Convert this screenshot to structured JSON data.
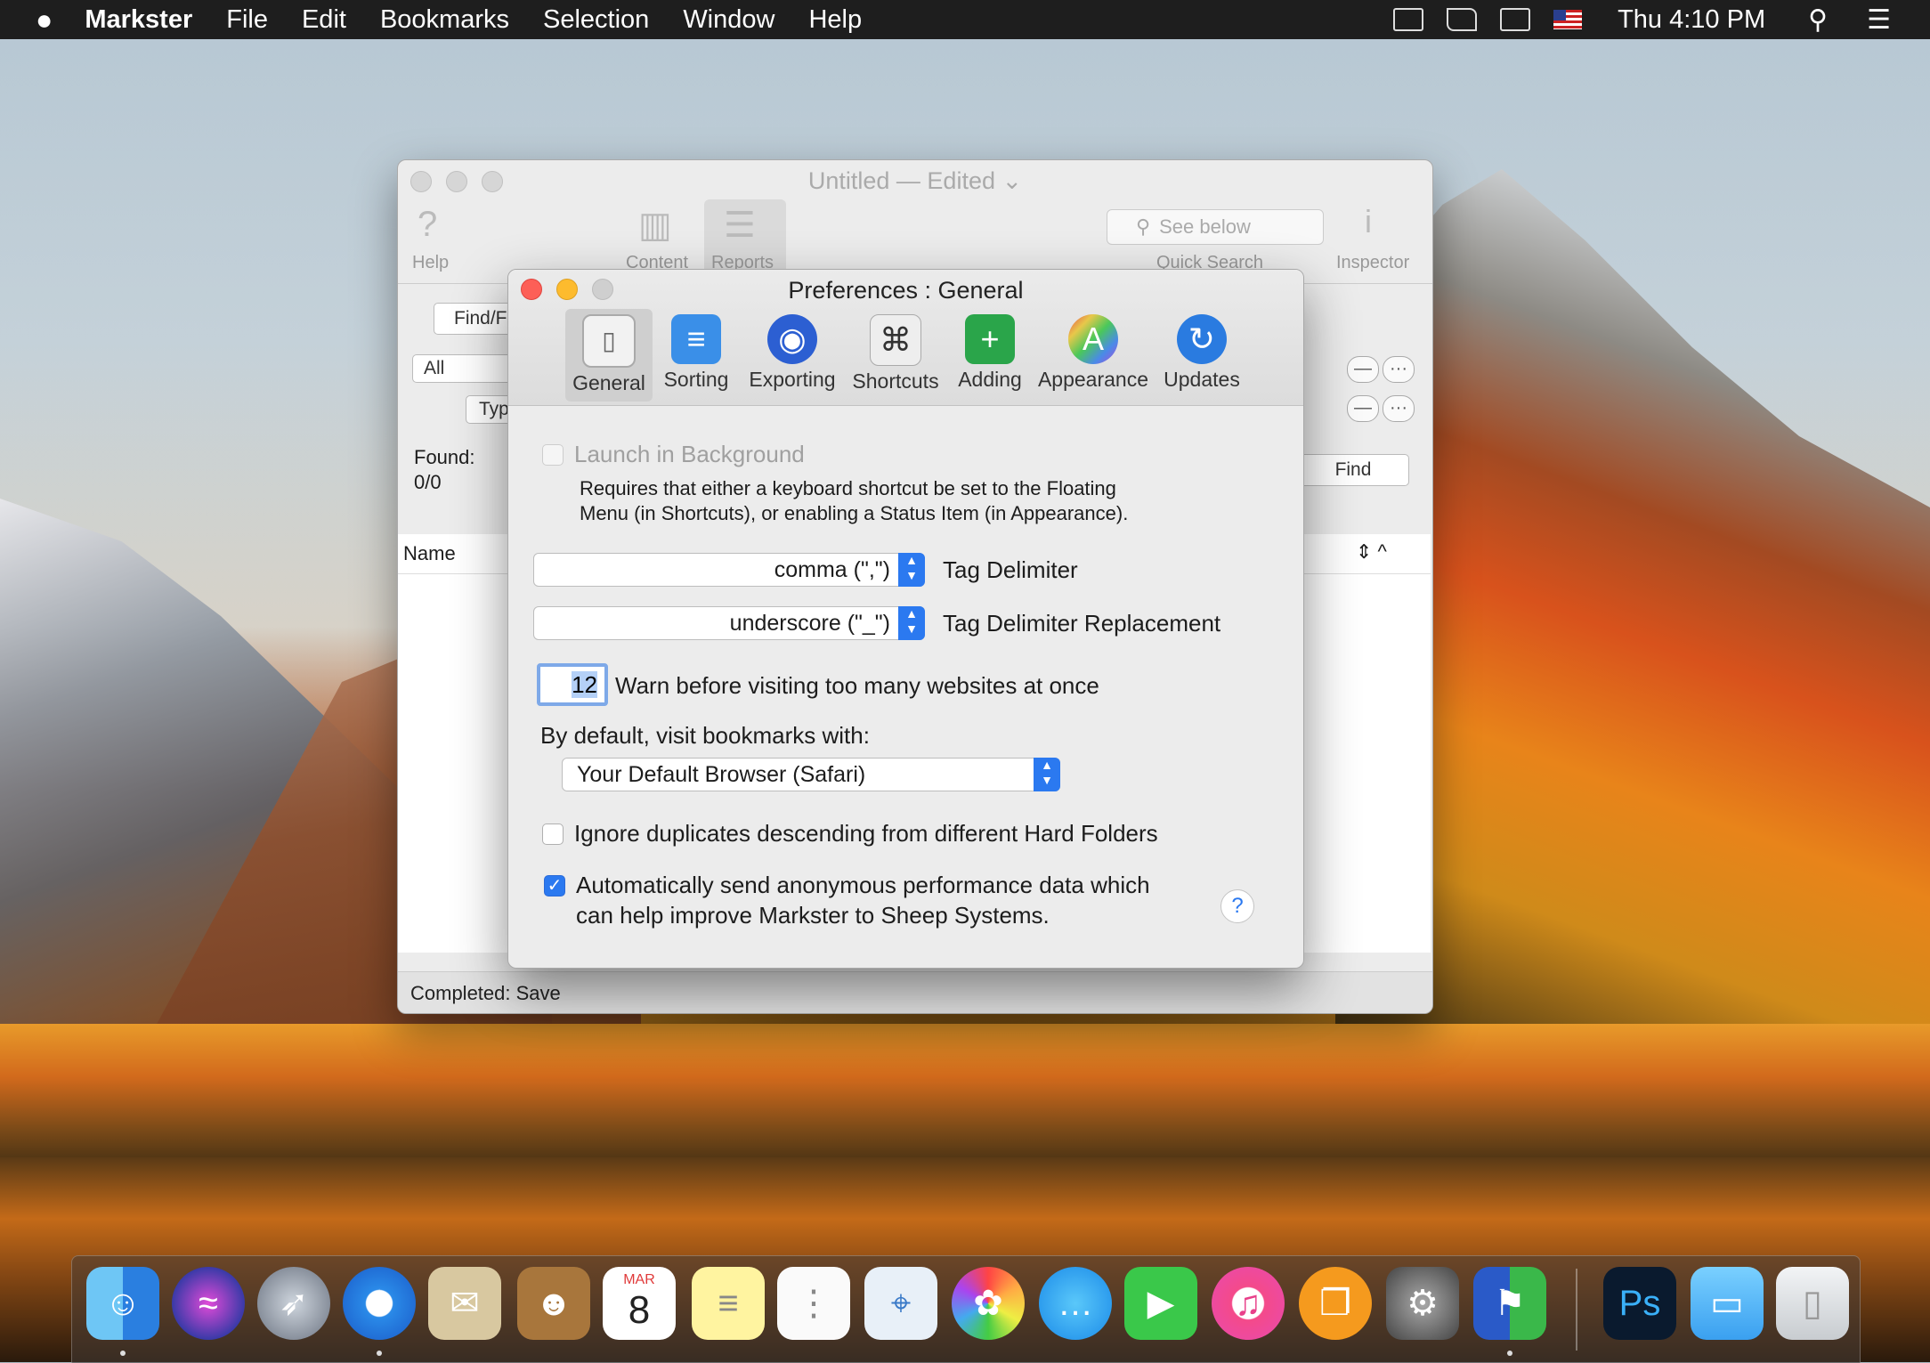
{
  "menubar": {
    "apple": "",
    "app_name": "Markster",
    "menus": [
      "File",
      "Edit",
      "Bookmarks",
      "Selection",
      "Window",
      "Help"
    ],
    "clock": "Thu 4:10 PM"
  },
  "main_window": {
    "title": "Untitled — Edited ⌄",
    "toolbar": {
      "help_label": "Help",
      "content_label": "Content",
      "reports_label": "Reports",
      "search_placeholder": "See below",
      "quick_search_label": "Quick Search",
      "inspector_label": "Inspector"
    },
    "find_button": "Find/F",
    "scope_popup": "All",
    "type_popup": "Typ",
    "found_label": "Found:",
    "found_value": "0/0",
    "find_action": "Find",
    "column_name": "Name",
    "status": "Completed: Save"
  },
  "prefs": {
    "title": "Preferences : General",
    "tabs": [
      {
        "label": "General",
        "icon": "general-switch-icon",
        "color": "#d8d8d8"
      },
      {
        "label": "Sorting",
        "icon": "sorting-stack-icon",
        "color": "#3a8fe8"
      },
      {
        "label": "Exporting",
        "icon": "exporting-arrows-icon",
        "color": "#2c5fd2"
      },
      {
        "label": "Shortcuts",
        "icon": "command-key-icon",
        "color": "#9a9a9a"
      },
      {
        "label": "Adding",
        "icon": "adding-plus-icon",
        "color": "#2aa54a"
      },
      {
        "label": "Appearance",
        "icon": "appearance-a-icon",
        "color": "#b04ad8"
      },
      {
        "label": "Updates",
        "icon": "updates-refresh-icon",
        "color": "#2a7be0"
      }
    ],
    "launch_bg_label": "Launch in Background",
    "launch_bg_note_1": "Requires that either a keyboard shortcut be set to the Floating",
    "launch_bg_note_2": "Menu (in Shortcuts), or enabling a Status Item (in Appearance).",
    "tag_delimiter_value": "comma (\",\")",
    "tag_delimiter_label": "Tag Delimiter",
    "tag_replacement_value": "underscore (\"_\")",
    "tag_replacement_label": "Tag Delimiter Replacement",
    "warn_count": "12",
    "warn_label": "Warn before visiting too many websites at once",
    "visit_label": "By default, visit bookmarks with:",
    "browser_value": "Your Default Browser (Safari)",
    "ignore_dupes_label": "Ignore duplicates descending from different Hard Folders",
    "perf_label_1": "Automatically send anonymous performance data which",
    "perf_label_2": "can help improve Markster to Sheep Systems.",
    "help_glyph": "?"
  },
  "dock": {
    "calendar_month": "MAR",
    "calendar_day": "8",
    "photoshop_label": "Ps"
  }
}
